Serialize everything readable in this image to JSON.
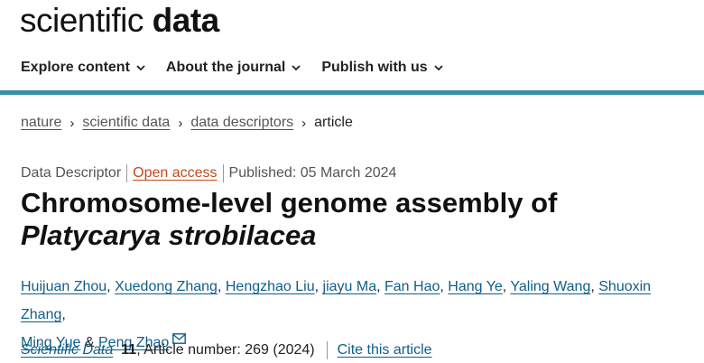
{
  "header": {
    "logo_light": "scientific ",
    "logo_bold": "data"
  },
  "nav": {
    "items": [
      {
        "label": "Explore content"
      },
      {
        "label": "About the journal"
      },
      {
        "label": "Publish with us"
      }
    ],
    "accent_color": "#3a8fa8"
  },
  "breadcrumb": {
    "items": [
      {
        "label": "nature"
      },
      {
        "label": "scientific data"
      },
      {
        "label": "data descriptors"
      },
      {
        "label": "article"
      }
    ],
    "separator": "›"
  },
  "article_meta": {
    "type": "Data Descriptor",
    "access": "Open access",
    "published": "Published: 05 March 2024"
  },
  "title": {
    "plain": "Chromosome-level genome assembly of ",
    "italic": "Platycarya strobilacea"
  },
  "authors": [
    {
      "name": "Huijuan Zhou"
    },
    {
      "name": "Xuedong Zhang"
    },
    {
      "name": "Hengzhao Liu"
    },
    {
      "name": "jiayu Ma"
    },
    {
      "name": "Fan Hao"
    },
    {
      "name": "Hang Ye"
    },
    {
      "name": "Yaling Wang"
    },
    {
      "name": "Shuoxin Zhang"
    },
    {
      "name": "Ming Yue"
    },
    {
      "name": "Peng Zhao"
    }
  ],
  "author_joiners": {
    "comma": ",",
    "and": "&"
  },
  "citation": {
    "journal": "Scientific Data",
    "volume": "11",
    "details": ", Article number: 269 (2024)",
    "cite_link": "Cite this article"
  },
  "colors": {
    "link": "#0f5e8a",
    "open_access": "#c0491b"
  }
}
